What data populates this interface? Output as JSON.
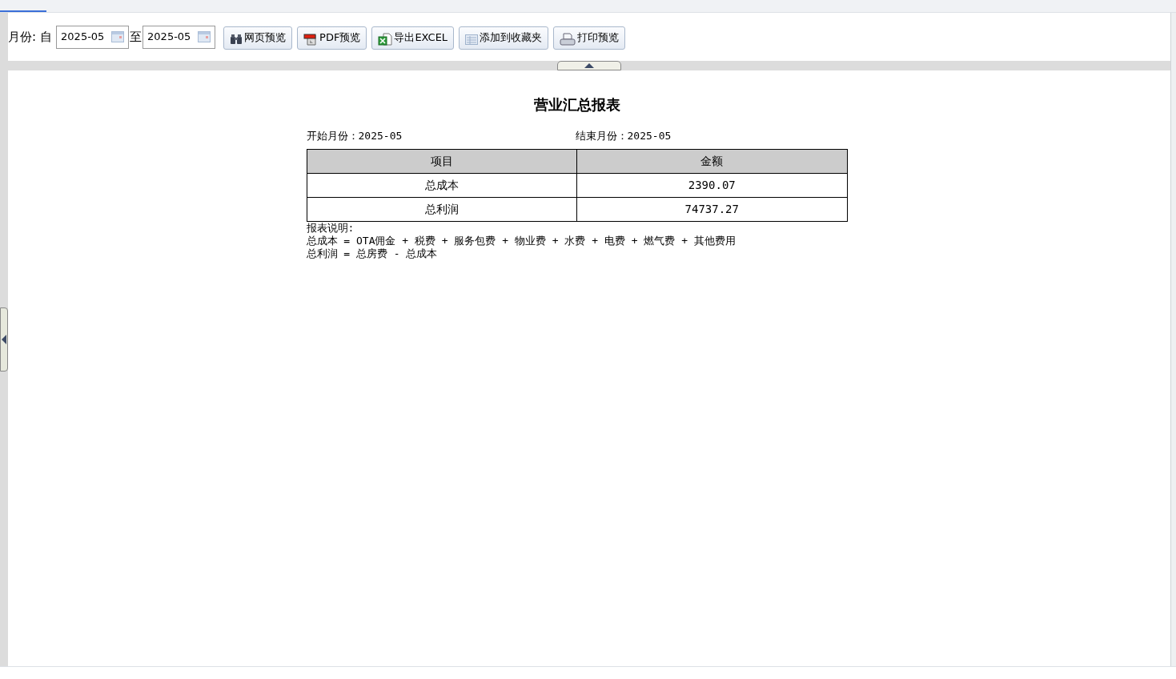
{
  "toolbar": {
    "month_label": "月份:",
    "from_label": "自",
    "from_value": "2025-05",
    "to_label": "至",
    "to_value": "2025-05",
    "buttons": [
      {
        "kind": "web",
        "label": "网页预览"
      },
      {
        "kind": "pdf",
        "label": "PDF预览"
      },
      {
        "kind": "excel",
        "label": "导出EXCEL"
      },
      {
        "kind": "favorite",
        "label": "添加到收藏夹"
      },
      {
        "kind": "print",
        "label": "打印预览"
      }
    ]
  },
  "report": {
    "title": "营业汇总报表",
    "start_month": "开始月份：2025-05",
    "end_month": "结束月份：2025-05",
    "table": {
      "columns": [
        "项目",
        "金额"
      ],
      "rows": [
        [
          "总成本",
          "2390.07"
        ],
        [
          "总利润",
          "74737.27"
        ]
      ]
    },
    "notes": [
      "报表说明:",
      "总成本 = OTA佣金 + 税费 + 服务包费 + 物业费 + 水费 + 电费 + 燃气费 + 其他费用",
      "总利润 = 总房费 - 总成本"
    ]
  }
}
